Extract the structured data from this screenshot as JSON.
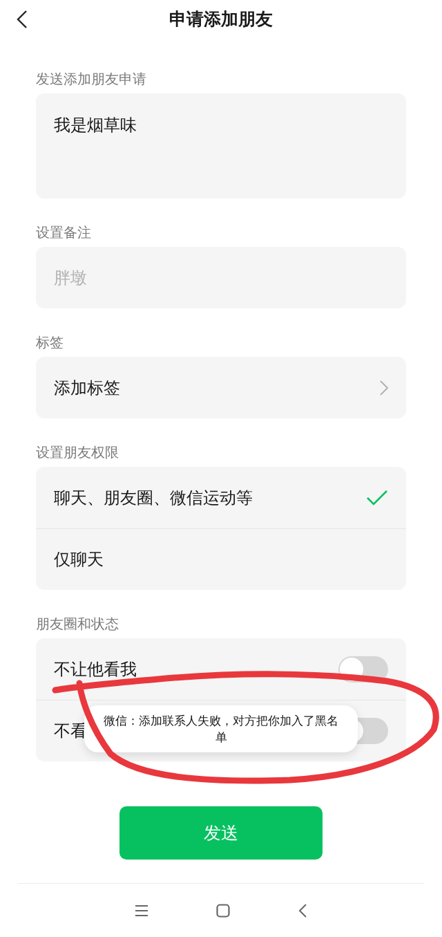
{
  "header": {
    "title": "申请添加朋友"
  },
  "request": {
    "label": "发送添加朋友申请",
    "value": "我是烟草味"
  },
  "remark": {
    "label": "设置备注",
    "placeholder": "胖墩"
  },
  "tags": {
    "label": "标签",
    "action": "添加标签"
  },
  "permissions": {
    "label": "设置朋友权限",
    "options": [
      {
        "label": "聊天、朋友圈、微信运动等",
        "selected": true
      },
      {
        "label": "仅聊天",
        "selected": false
      }
    ]
  },
  "moments": {
    "label": "朋友圈和状态",
    "items": [
      {
        "label": "不让他看我",
        "on": false
      },
      {
        "label": "不看",
        "on": false
      }
    ]
  },
  "send_button": "发送",
  "toast": "微信：添加联系人失败，对方把你加入了黑名单"
}
